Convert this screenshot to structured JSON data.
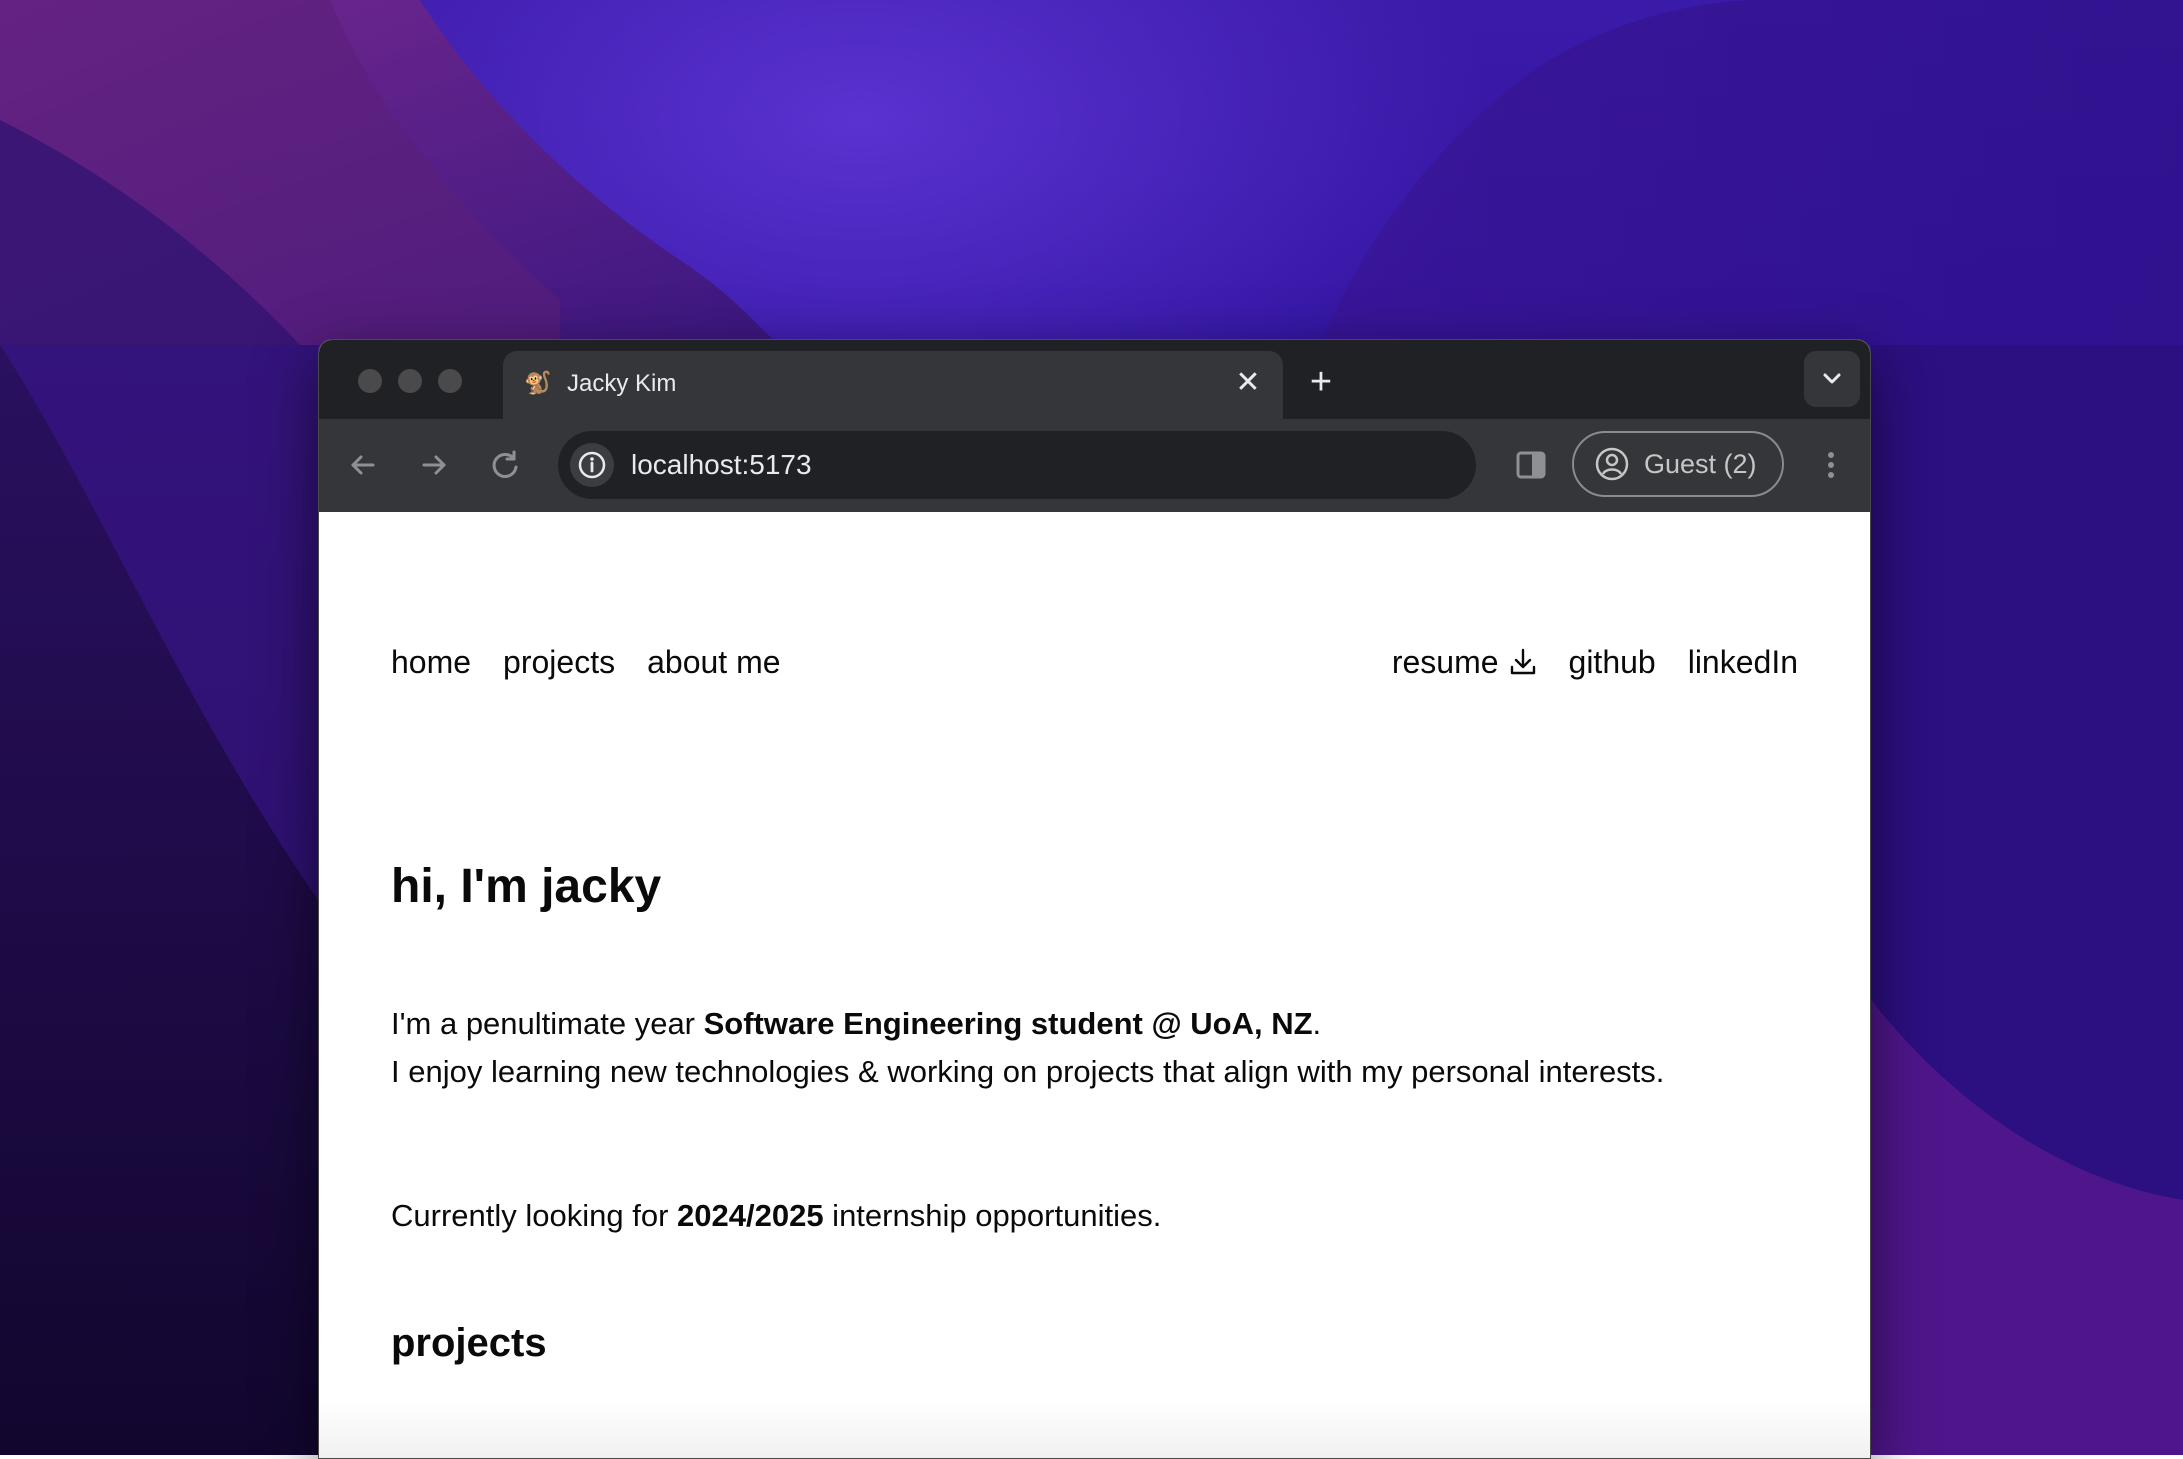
{
  "browser": {
    "tab_title": "Jacky Kim",
    "tab_favicon": "🐒",
    "close_glyph": "✕",
    "new_tab_glyph": "+",
    "url": "localhost:5173",
    "profile_label": "Guest (2)"
  },
  "nav": {
    "left": [
      "home",
      "projects",
      "about me"
    ],
    "resume_label": "resume",
    "github_label": "github",
    "linkedin_label": "linkedIn"
  },
  "hero": {
    "title": "hi, I'm jacky",
    "intro_prefix": "I'm a penultimate year ",
    "intro_bold": "Software Engineering student @ UoA, NZ",
    "intro_suffix": ".",
    "line2": "I enjoy learning new technologies & working on projects that align with my personal interests.",
    "cta_prefix": "Currently looking for ",
    "cta_bold": "2024/2025",
    "cta_suffix": " internship opportunities."
  },
  "sections": {
    "projects_title": "projects"
  },
  "colors": {
    "desktop_bg": "#2e12a0",
    "tabstrip_bg": "#202124",
    "toolbar_bg": "#35363a",
    "page_text": "#0a0a0a"
  },
  "icons": [
    "back-arrow-icon",
    "forward-arrow-icon",
    "reload-icon",
    "info-icon",
    "side-panel-icon",
    "profile-icon",
    "more-vert-icon",
    "download-icon",
    "chevron-down-icon"
  ]
}
